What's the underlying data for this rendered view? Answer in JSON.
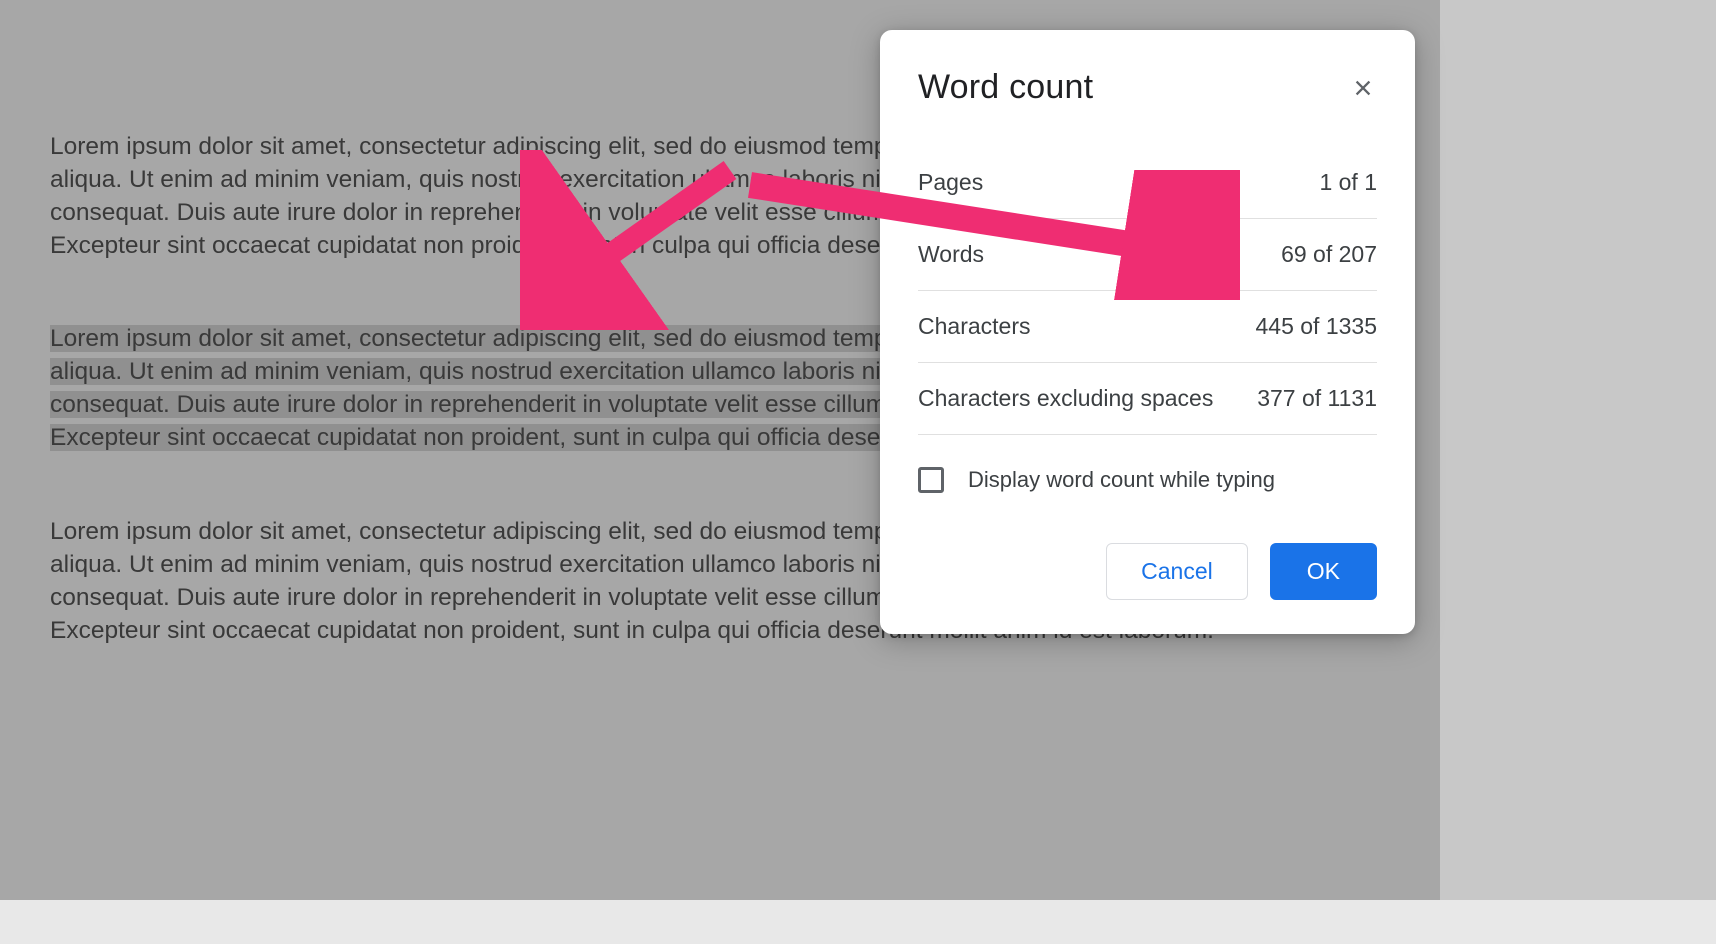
{
  "document": {
    "paragraph1": "Lorem ipsum dolor sit amet, consectetur adipiscing elit, sed do eiusmod tempor incididunt ut labore et dolore magna aliqua. Ut enim ad minim veniam, quis nostrud exercitation ullamco laboris nisi ut aliquip ex ea commodo consequat. Duis aute irure dolor in reprehenderit in voluptate velit esse cillum dolore eu fugiat nulla pariatur. Excepteur sint occaecat cupidatat non proident, sunt in culpa qui officia deserunt mollit anim id est laborum.",
    "paragraph2": "Lorem ipsum dolor sit amet, consectetur adipiscing elit, sed do eiusmod tempor incididunt ut labore et dolore magna aliqua. Ut enim ad minim veniam, quis nostrud exercitation ullamco laboris nisi ut aliquip ex ea commodo consequat. Duis aute irure dolor in reprehenderit in voluptate velit esse cillum dolore eu fugiat nulla pariatur. Excepteur sint occaecat cupidatat non proident, sunt in culpa qui officia deserunt mollit anim id est laborum.",
    "paragraph3": "Lorem ipsum dolor sit amet, consectetur adipiscing elit, sed do eiusmod tempor incididunt ut labore et dolore magna aliqua. Ut enim ad minim veniam, quis nostrud exercitation ullamco laboris nisi ut aliquip ex ea commodo consequat. Duis aute irure dolor in reprehenderit in voluptate velit esse cillum dolore eu fugiat nulla pariatur. Excepteur sint occaecat cupidatat non proident, sunt in culpa qui officia deserunt mollit anim id est laborum."
  },
  "dialog": {
    "title": "Word count",
    "stats": {
      "pages_label": "Pages",
      "pages_value": "1 of 1",
      "words_label": "Words",
      "words_value": "69 of 207",
      "chars_label": "Characters",
      "chars_value": "445 of 1335",
      "chars_no_spaces_label": "Characters excluding spaces",
      "chars_no_spaces_value": "377 of 1131"
    },
    "checkbox_label": "Display word count while typing",
    "cancel_label": "Cancel",
    "ok_label": "OK"
  },
  "annotation": {
    "arrow_color": "#ef2d72"
  }
}
